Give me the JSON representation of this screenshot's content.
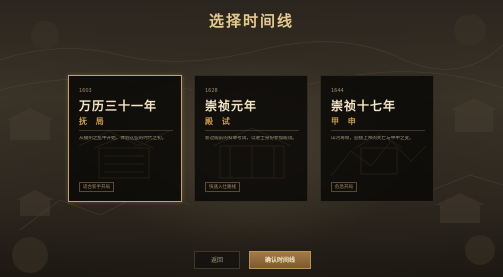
{
  "title": "选择时间线",
  "cards": [
    {
      "year": "1603",
      "era": "万历三十一年",
      "subtitle": "抚 局",
      "description": "从播州之乱中开始，体验这些的时代之初。",
      "tag": "适合新手开局",
      "selected": true
    },
    {
      "year": "1628",
      "era": "崇祯元年",
      "subtitle": "殿 试",
      "description": "新过殿前的科举考试，以进士身份参加殿试。",
      "tag": "快速入仕路线",
      "selected": false
    },
    {
      "year": "1644",
      "era": "崇祯十七年",
      "subtitle": "甲 申",
      "description": "山河将倾，迎接上帝的死亡与甲申之变。",
      "tag": "危急开局",
      "selected": false
    }
  ],
  "buttons": {
    "back": "返回",
    "confirm": "确认时间线"
  }
}
